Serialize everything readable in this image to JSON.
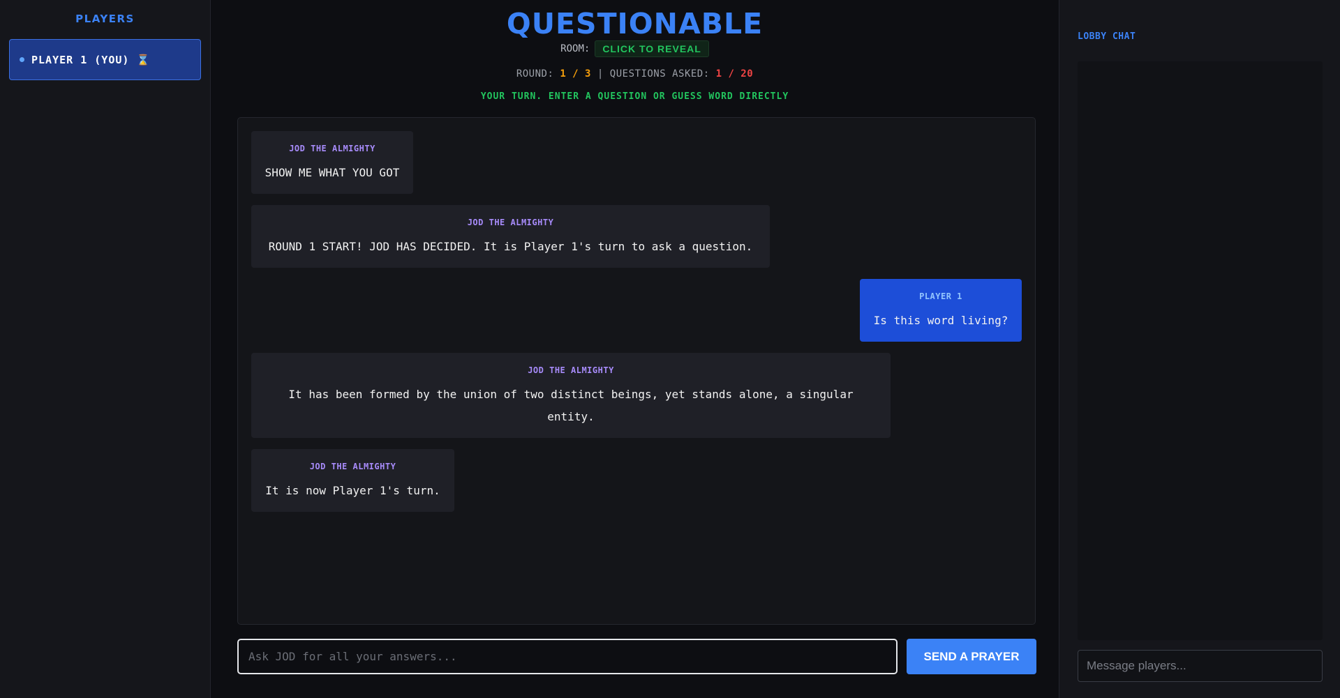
{
  "sidebar_left": {
    "title": "PLAYERS",
    "players": [
      {
        "label": "PLAYER 1 (YOU)",
        "status_icon": "⌛"
      }
    ]
  },
  "header": {
    "title": "QUESTIONABLE",
    "room_label": "ROOM:",
    "room_button": "CLICK TO REVEAL",
    "round_label": "ROUND:",
    "round_value": "1 / 3",
    "separator": "|",
    "questions_label": "QUESTIONS ASKED:",
    "questions_value": "1 / 20",
    "turn_message": "YOUR TURN. ENTER A QUESTION OR GUESS WORD DIRECTLY"
  },
  "messages": [
    {
      "author": "JOD THE ALMIGHTY",
      "text": "SHOW ME WHAT YOU GOT"
    },
    {
      "author": "JOD THE ALMIGHTY",
      "text": "ROUND 1 START! JOD HAS DECIDED. It is Player 1's turn to ask a question."
    },
    {
      "author": "PLAYER 1",
      "text": "Is this word living?"
    },
    {
      "author": "JOD THE ALMIGHTY",
      "text": "It has been formed by the union of two distinct beings, yet stands alone, a singular entity."
    },
    {
      "author": "JOD THE ALMIGHTY",
      "text": "It is now Player 1's turn."
    }
  ],
  "composer": {
    "placeholder": "Ask JOD for all your answers...",
    "send_label": "SEND A PRAYER"
  },
  "lobby": {
    "title": "LOBBY CHAT",
    "input_placeholder": "Message players..."
  },
  "colors": {
    "accent_blue": "#3b82f6",
    "success_green": "#22c55e",
    "warning_orange": "#f59e0b",
    "danger_red": "#ef4444",
    "author_purple": "#a78bfa"
  }
}
